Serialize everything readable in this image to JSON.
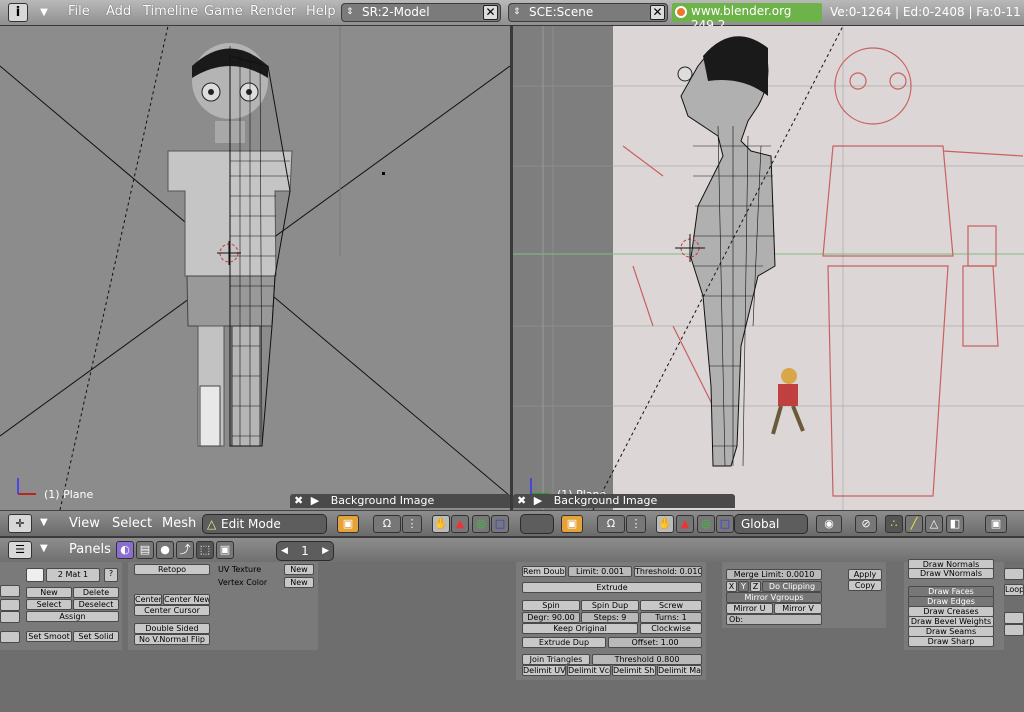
{
  "menubar": {
    "info_icon": "info-icon",
    "menus": [
      "File",
      "Add",
      "Timeline",
      "Game",
      "Render",
      "Help"
    ],
    "screen": "SR:2-Model",
    "scene": "SCE:Scene",
    "url": "www.blender.org 249.2",
    "stats": "Ve:0-1264 | Ed:0-2408 | Fa:0-11"
  },
  "viewport_left": {
    "object_label": "(1) Plane",
    "bg_panel": "Background Image"
  },
  "viewport_right": {
    "object_label": "(1) Plane",
    "bg_panel": "Background Image"
  },
  "view3d_header": {
    "menus": [
      "View",
      "Select",
      "Mesh"
    ],
    "mode": "Edit Mode",
    "orientation": "Global"
  },
  "buttons_header": {
    "panels": "Panels",
    "frame": "1"
  },
  "link_panel": {
    "mat": "2 Mat 1",
    "buttons": [
      "New",
      "Delete",
      "Select",
      "Deselect",
      "Assign",
      "Set Smoot",
      "Set Solid"
    ]
  },
  "mesh_panel": {
    "retopo": "Retopo",
    "uv_texture": "UV Texture",
    "vertex_color": "Vertex Color",
    "new1": "New",
    "new2": "New",
    "center_new": "Center New",
    "center": "Center",
    "center_cursor": "Center Cursor",
    "double_sided": "Double Sided",
    "no_vnormal_flip": "No V.Normal Flip"
  },
  "tools_panel": {
    "rem_doubl": "Rem Doubl",
    "limit": "Limit: 0.001",
    "threshold": "Threshold: 0.010",
    "extrude": "Extrude",
    "spin": "Spin",
    "spin_dup": "Spin Dup",
    "screw": "Screw",
    "degr": "Degr: 90.00",
    "steps": "Steps: 9",
    "turns": "Turns: 1",
    "keep_original": "Keep Original",
    "clockwise": "Clockwise",
    "extrude_dup": "Extrude Dup",
    "offset": "Offset: 1.00",
    "join_triangles": "Join Triangles",
    "threshold2": "Threshold 0.800",
    "delimit": [
      "Delimit UV",
      "Delimit Vco",
      "Delimit Sha",
      "Delimit Ma"
    ]
  },
  "modifiers_panel": {
    "merge_limit": "Merge Limit: 0.0010",
    "x": "X",
    "y": "Y",
    "z": "Z",
    "do_clipping": "Do Clipping",
    "mirror_vgroups": "Mirror Vgroups",
    "mirror_u": "Mirror U",
    "mirror_v": "Mirror V",
    "ob": "Ob:",
    "apply": "Apply",
    "copy": "Copy"
  },
  "draw_panel": {
    "items": [
      "Draw Normals",
      "Draw VNormals",
      "Draw Faces",
      "Draw Edges",
      "Draw Creases",
      "Draw Bevel Weights",
      "Draw Seams",
      "Draw Sharp"
    ],
    "edge_right": "Loop"
  },
  "colors": {
    "url_bg": "#6db34a",
    "edit_wire": "#111111"
  }
}
